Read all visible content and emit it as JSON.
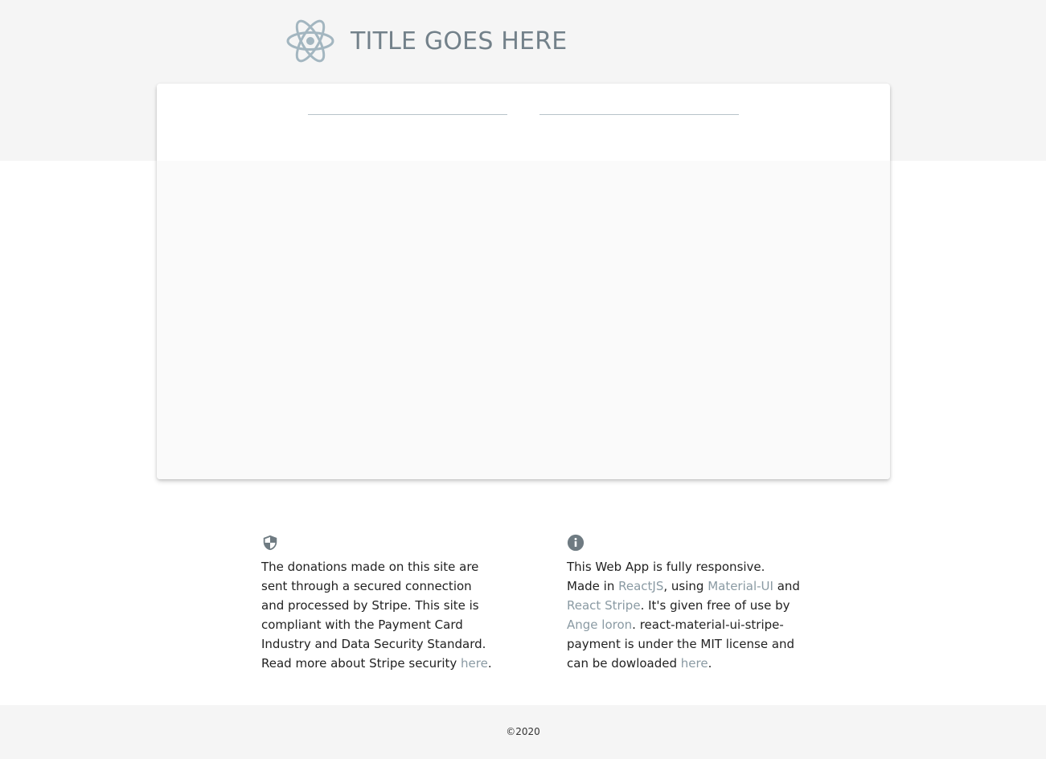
{
  "header": {
    "title": "TITLE GOES HERE",
    "logo_icon": "react-atom-icon",
    "logo_color": "#a3b6c0"
  },
  "form": {
    "field_left_value": "",
    "field_right_value": ""
  },
  "security_info": {
    "icon": "shield-icon",
    "text_before_link": "The donations made on this site are sent through a secured connection and processed by Stripe. This site is compliant with the Payment Card Industry and Data Security Standard. Read more about Stripe security ",
    "link_here": "here",
    "text_after_link": "."
  },
  "app_info": {
    "icon": "info-icon",
    "text_1": "This Web App is fully responsive. Made in ",
    "link_reactjs": "ReactJS",
    "text_2": ", using ",
    "link_material_ui": "Material-UI",
    "text_3": " and ",
    "link_react_stripe": "React Stripe",
    "text_4": ". It's given free of use by ",
    "link_author": "Ange loron",
    "text_5": ". react-material-ui-stripe-payment is under the MIT license and can be dowloaded ",
    "link_here": "here",
    "text_6": "."
  },
  "footer": {
    "copyright": "©2020"
  },
  "colors": {
    "hero_background": "#f5f5f5",
    "link": "#8a9aa3",
    "title": "#73818a",
    "icon": "#6f7b82"
  }
}
